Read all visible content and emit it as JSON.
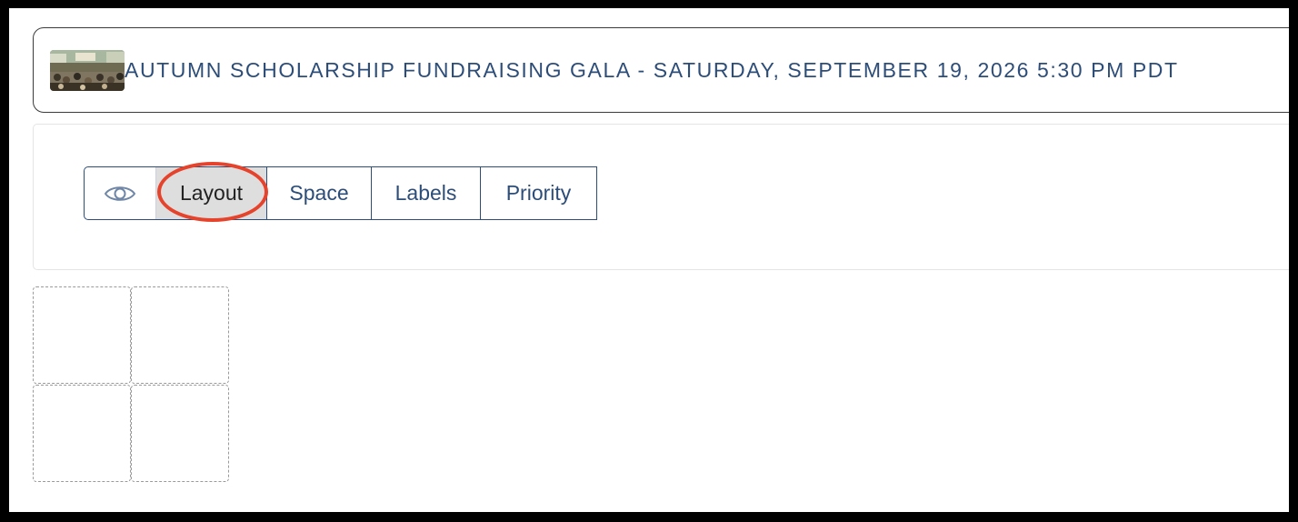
{
  "event": {
    "title": "AUTUMN SCHOLARSHIP FUNDRAISING GALA - SATURDAY, SEPTEMBER 19, 2026 5:30 PM PDT",
    "thumbnail_icon": "event-photo"
  },
  "view_toolbar": {
    "visibility_icon": "eye-icon",
    "tabs": [
      {
        "label": "Layout",
        "selected": true
      },
      {
        "label": "Space",
        "selected": false
      },
      {
        "label": "Labels",
        "selected": false
      },
      {
        "label": "Priority",
        "selected": false
      }
    ]
  },
  "layout_grid": {
    "cells": 4
  },
  "colors": {
    "primary_text": "#2d4d79",
    "selected_tab_bg": "#dedede",
    "annotation": "#e5432b"
  }
}
